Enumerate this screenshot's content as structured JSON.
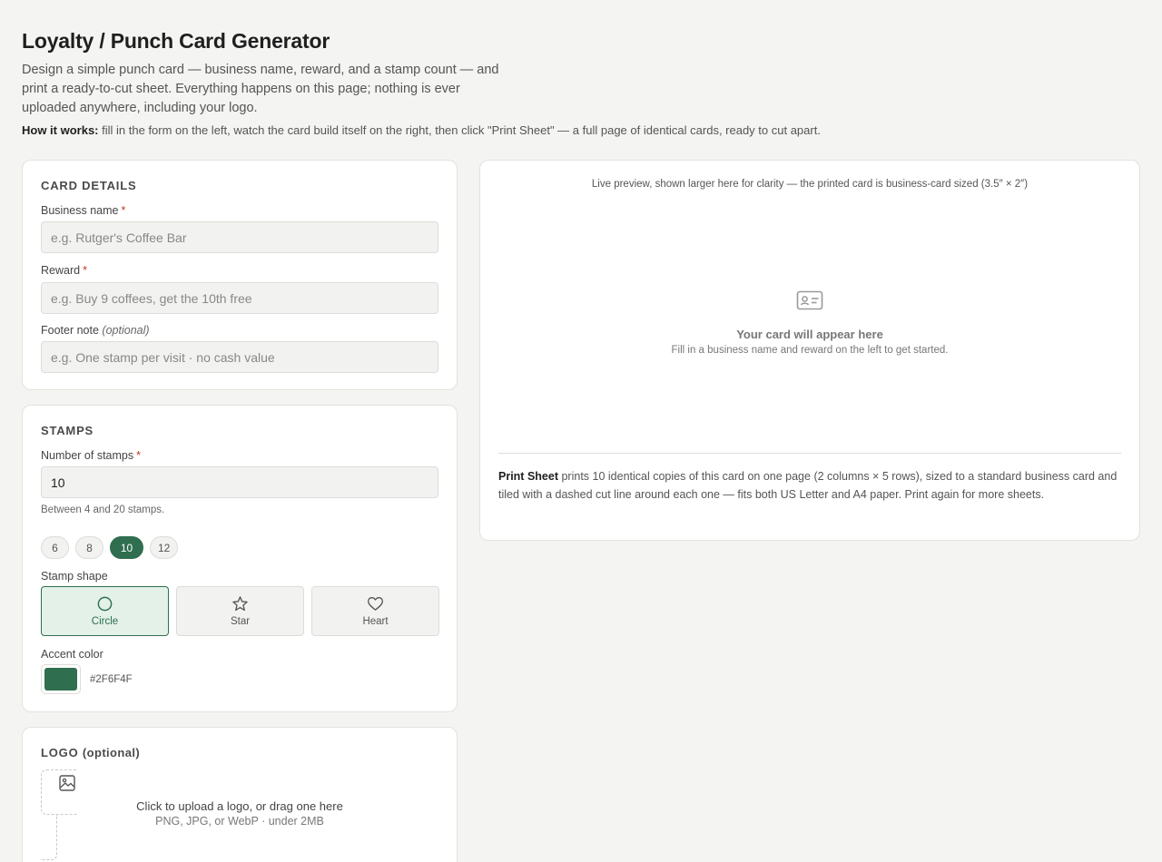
{
  "header": {
    "title": "Loyalty / Punch Card Generator",
    "intro": "Design a simple punch card — business name, reward, and a stamp count — and print a ready-to-cut sheet. Everything happens on this page; nothing is ever uploaded anywhere, including your logo.",
    "how_label": "How it works:",
    "how_text": "fill in the form on the left, watch the card build itself on the right, then click \"Print Sheet\" — a full page of identical cards, ready to cut apart."
  },
  "card_details": {
    "title": "CARD DETAILS",
    "business_label": "Business name",
    "business_placeholder": "e.g. Rutger's Coffee Bar",
    "business_value": "",
    "reward_label": "Reward",
    "reward_placeholder": "e.g. Buy 9 coffees, get the 10th free",
    "reward_value": "",
    "footer_label": "Footer note",
    "footer_optional": "(optional)",
    "footer_placeholder": "e.g. One stamp per visit · no cash value",
    "footer_value": "",
    "required_mark": "*"
  },
  "stamps": {
    "title": "STAMPS",
    "count_label": "Number of stamps",
    "count_value": "10",
    "count_hint": "Between 4 and 20 stamps.",
    "presets": [
      "6",
      "8",
      "10",
      "12"
    ],
    "selected_preset": "10",
    "shape_label": "Stamp shape",
    "shapes": [
      {
        "label": "Circle",
        "icon": "circle-icon"
      },
      {
        "label": "Star",
        "icon": "star-icon"
      },
      {
        "label": "Heart",
        "icon": "heart-icon"
      }
    ],
    "selected_shape": "Circle",
    "accent_label": "Accent color",
    "accent_hex": "#2F6F4F",
    "accent_color": "#2f6f4f"
  },
  "logo": {
    "title": "LOGO",
    "title_suffix": "(optional)",
    "upload_main": "Click to upload a logo, or drag one here",
    "upload_sub": "PNG, JPG, or WebP · under 2MB",
    "icon": "image-icon"
  },
  "preview": {
    "caption": "Live preview, shown larger here for clarity — the printed card is business-card sized (3.5″ × 2″)",
    "empty_icon": "id-card-icon",
    "empty_title": "Your card will appear here",
    "empty_sub": "Fill in a business name and reward on the left to get started.",
    "print_label": "Print Sheet",
    "print_text": "prints 10 identical copies of this card on one page (2 columns × 5 rows), sized to a standard business card and tiled with a dashed cut line around each one — fits both US Letter and A4 paper. Print again for more sheets."
  }
}
